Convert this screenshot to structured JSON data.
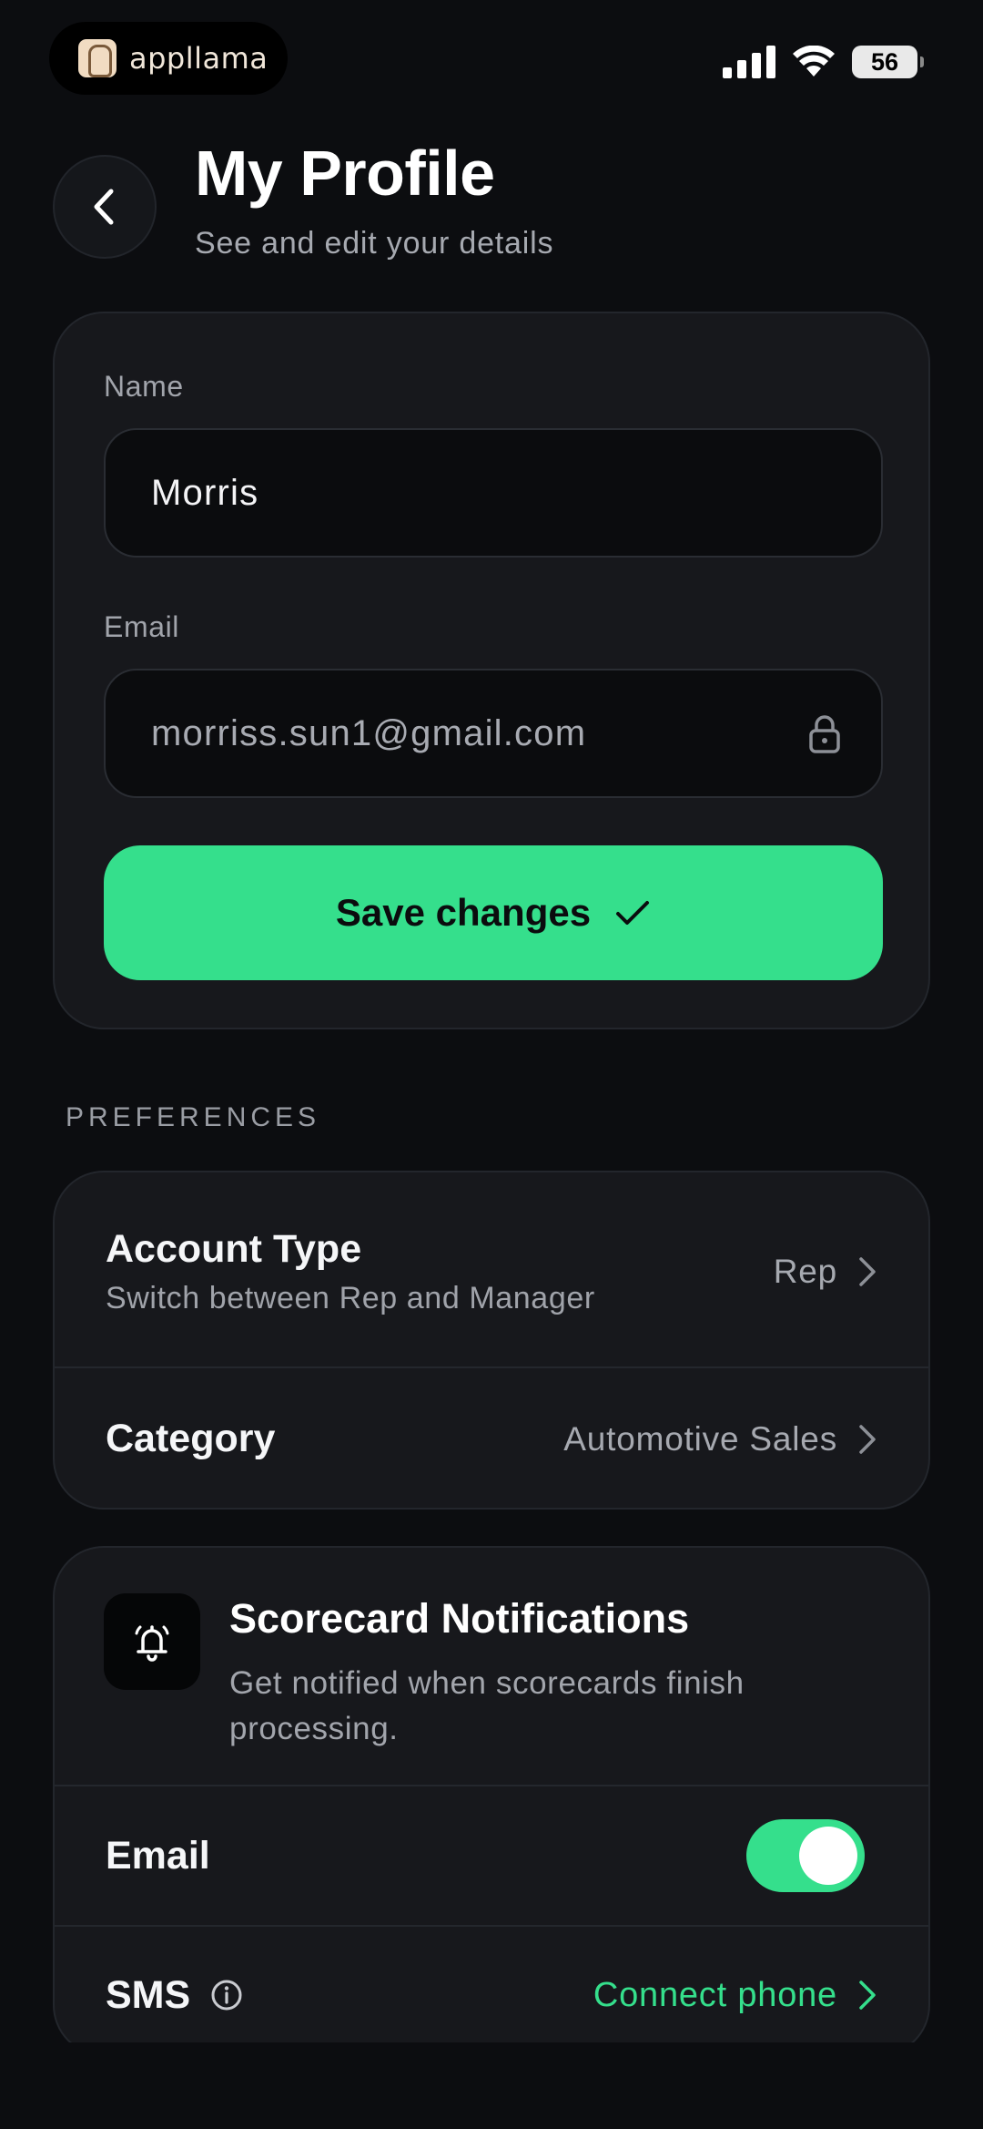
{
  "status_bar": {
    "brand_name": "appllama",
    "battery_level": "56"
  },
  "header": {
    "title": "My Profile",
    "subtitle": "See and edit your details"
  },
  "form": {
    "name_label": "Name",
    "name_value": "Morris",
    "email_label": "Email",
    "email_value": "morriss.sun1@gmail.com",
    "save_label": "Save changes"
  },
  "preferences": {
    "section_label": "PREFERENCES",
    "account_type": {
      "title": "Account Type",
      "subtitle": "Switch between Rep and Manager",
      "value": "Rep"
    },
    "category": {
      "title": "Category",
      "value": "Automotive Sales"
    }
  },
  "notifications": {
    "title": "Scorecard Notifications",
    "description": "Get notified when scorecards finish processing.",
    "email_label": "Email",
    "email_enabled": true,
    "sms_label": "SMS",
    "sms_action": "Connect phone"
  },
  "colors": {
    "accent": "#35df8c",
    "background": "#0c0d10",
    "card": "#17181c"
  },
  "icons": [
    "back-chevron-icon",
    "lock-icon",
    "checkmark-icon",
    "chevron-right-icon",
    "bell-icon",
    "info-icon",
    "signal-icon",
    "wifi-icon",
    "battery-icon"
  ]
}
